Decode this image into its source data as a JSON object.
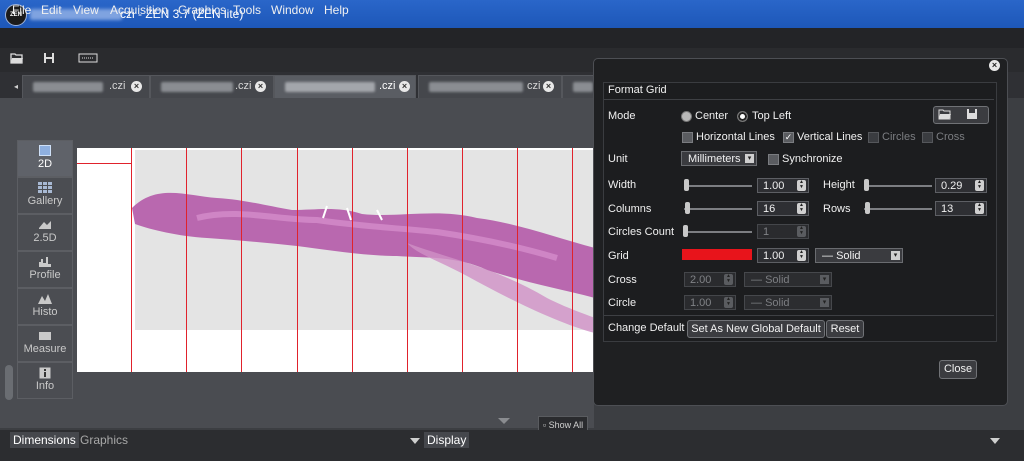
{
  "window": {
    "title": "czi - ZEN 3.7 (ZEN lite)",
    "logo": "ZEN"
  },
  "menu": [
    "File",
    "Edit",
    "View",
    "Acquisition",
    "Graphics",
    "Tools",
    "Window",
    "Help"
  ],
  "tabs": [
    {
      "label": ".czi"
    },
    {
      "label": ".czi"
    },
    {
      "label": ".czi"
    },
    {
      "label": "czi"
    }
  ],
  "side_tools": [
    "2D",
    "Gallery",
    "2.5D",
    "Profile",
    "Histo",
    "Measure",
    "Info"
  ],
  "show_all": "Show All",
  "bottom_tabs": [
    "Dimensions",
    "Graphics"
  ],
  "display_tab": "Display",
  "dialog": {
    "title": "Format Grid",
    "mode": {
      "label": "Mode",
      "opt_center": "Center",
      "opt_topleft": "Top Left"
    },
    "checks": {
      "horizontal": "Horizontal Lines",
      "vertical": "Vertical Lines",
      "circles": "Circles",
      "cross": "Cross"
    },
    "unit": {
      "label": "Unit",
      "value": "Millimeters",
      "sync": "Synchronize"
    },
    "width": {
      "label": "Width",
      "value": "1.00"
    },
    "height": {
      "label": "Height",
      "value": "0.29"
    },
    "columns": {
      "label": "Columns",
      "value": "16"
    },
    "rows": {
      "label": "Rows",
      "value": "13"
    },
    "circles_count": {
      "label": "Circles Count",
      "value": "1"
    },
    "grid": {
      "label": "Grid",
      "thickness": "1.00",
      "style": "Solid",
      "color": "#e8141b"
    },
    "cross": {
      "label": "Cross",
      "thickness": "2.00",
      "style": "Solid"
    },
    "circle": {
      "label": "Circle",
      "thickness": "1.00",
      "style": "Solid"
    },
    "change_default": {
      "label": "Change Default",
      "set_global": "Set As New Global Default",
      "reset": "Reset"
    },
    "close": "Close"
  }
}
